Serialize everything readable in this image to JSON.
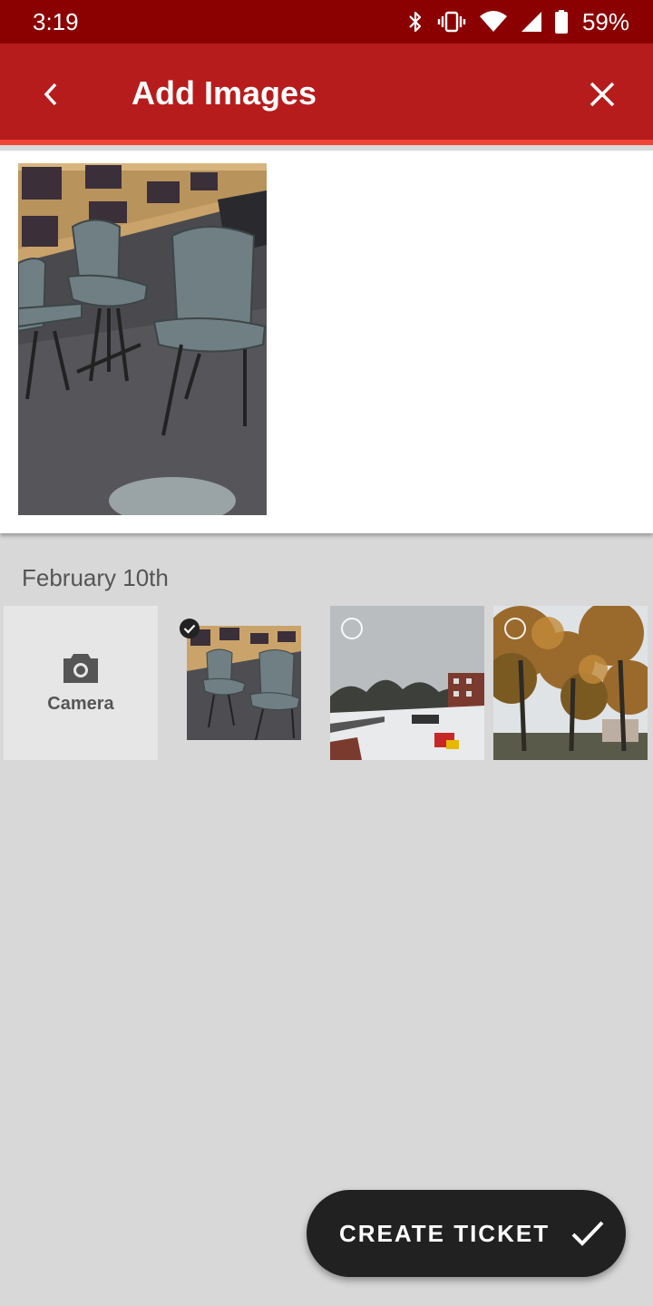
{
  "status_bar": {
    "time": "3:19",
    "battery": "59%",
    "icons": [
      "bluetooth-icon",
      "vibrate-icon",
      "wifi-icon",
      "signal-icon",
      "battery-icon"
    ]
  },
  "app_bar": {
    "title": "Add Images",
    "back_icon": "chevron-left-icon",
    "close_icon": "close-icon",
    "color": "#b71c1c",
    "accent": "#f04438"
  },
  "selected_images": [
    {
      "name": "library-chairs-photo"
    }
  ],
  "gallery": {
    "section_date": "February 10th",
    "camera_label": "Camera",
    "items": [
      {
        "name": "library-chairs-thumb",
        "selected": true
      },
      {
        "name": "snowy-playground-thumb",
        "selected": false
      },
      {
        "name": "autumn-trees-thumb",
        "selected": false
      }
    ]
  },
  "fab": {
    "label": "CREATE TICKET",
    "icon": "check-icon"
  }
}
